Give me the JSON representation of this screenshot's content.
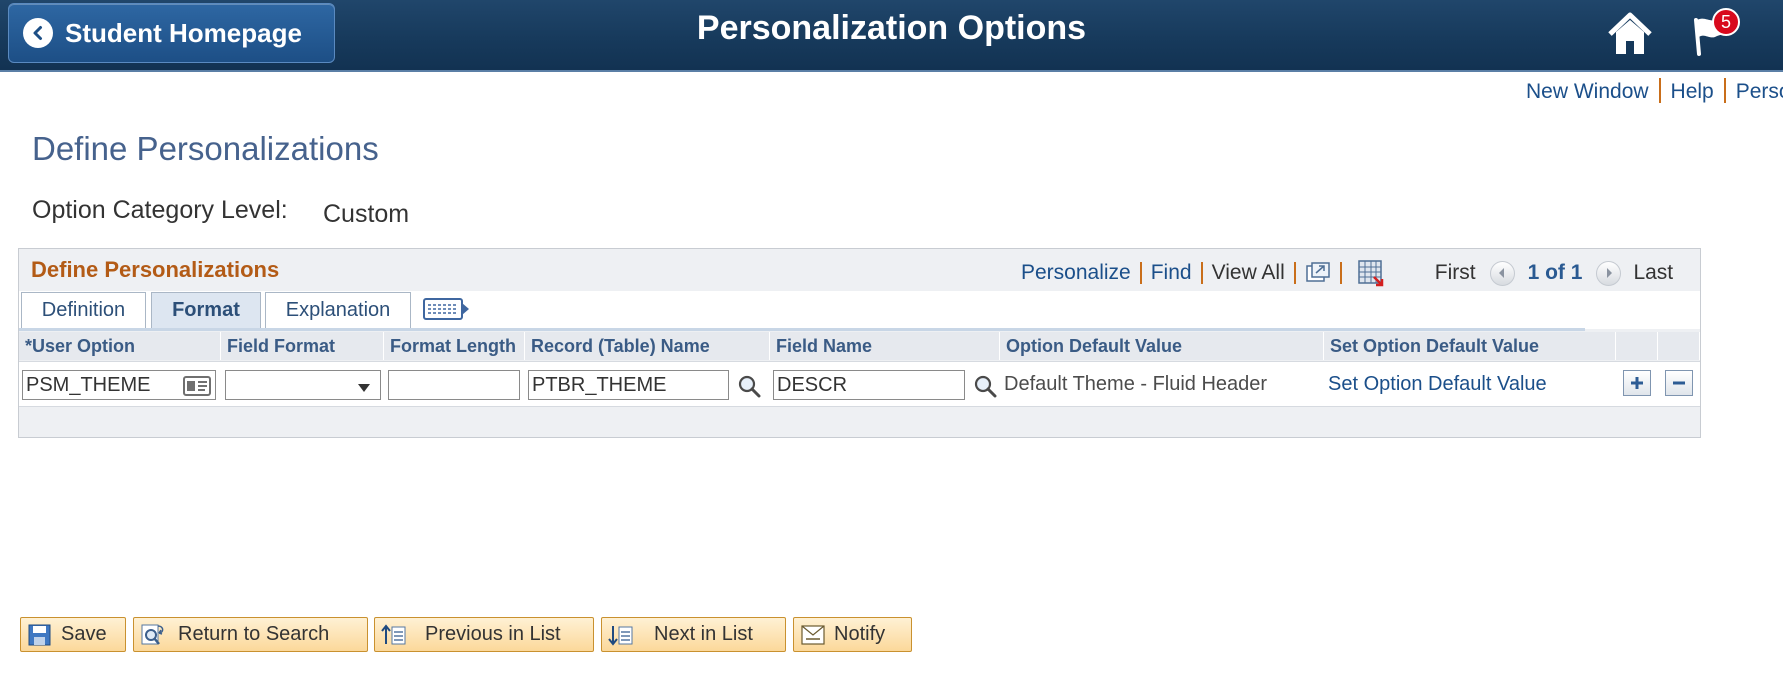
{
  "header": {
    "back_label": "Student Homepage",
    "title": "Personalization Options",
    "notification_count": "5"
  },
  "toplinks": [
    "New Window",
    "Help",
    "Perso"
  ],
  "page": {
    "heading": "Define Personalizations",
    "category_label": "Option Category Level:",
    "category_value": "Custom"
  },
  "grid": {
    "title": "Define Personalizations",
    "nav": {
      "personalize": "Personalize",
      "find": "Find",
      "view_all": "View All",
      "first": "First",
      "count": "1 of 1",
      "last": "Last"
    },
    "tabs": [
      {
        "label": "Definition",
        "active": false
      },
      {
        "label": "Format",
        "active": true
      },
      {
        "label": "Explanation",
        "active": false
      }
    ],
    "columns": [
      "User Option",
      "Field Format",
      "Format Length",
      "Record (Table) Name",
      "Field Name",
      "Option Default Value",
      "Set Option Default Value"
    ],
    "required_mark": "*",
    "row": {
      "user_option": "PSM_THEME",
      "field_format": "",
      "format_length": "",
      "record_name": "PTBR_THEME",
      "field_name": "DESCR",
      "option_default_value": "Default Theme - Fluid Header",
      "set_default_link": "Set Option Default Value"
    }
  },
  "buttons": {
    "save": "Save",
    "return_to_search": "Return to Search",
    "previous_in_list": "Previous in List",
    "next_in_list": "Next in List",
    "notify": "Notify"
  },
  "colors": {
    "header_bg": "#173a5c",
    "link": "#1b4f8a",
    "grid_title": "#b35b16",
    "separator": "#c96e1a",
    "button_bg": "#fbd89a"
  }
}
